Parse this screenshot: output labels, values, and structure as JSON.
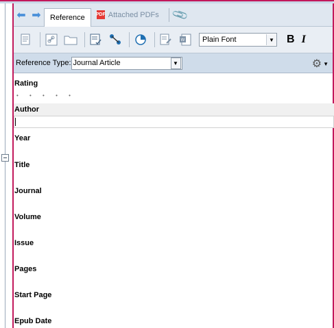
{
  "tabs": {
    "reference_label": "Reference",
    "attached_pdfs_label": "Attached PDFs"
  },
  "toolbar": {
    "font_select_value": "Plain Font",
    "bold_label": "B",
    "italic_label": "I"
  },
  "reference_type": {
    "label": "Reference Type:",
    "value": "Journal Article"
  },
  "fields": [
    {
      "label": "Rating"
    },
    {
      "label": "Author"
    },
    {
      "label": "Year"
    },
    {
      "label": "Title"
    },
    {
      "label": "Journal"
    },
    {
      "label": "Volume"
    },
    {
      "label": "Issue"
    },
    {
      "label": "Pages"
    },
    {
      "label": "Start Page"
    },
    {
      "label": "Epub Date"
    }
  ],
  "rating_dots": "• • • • •",
  "colors": {
    "accent_pink": "#c2185b",
    "toolbar_bg": "#e9eef4",
    "reftype_bg": "#cfdcea"
  }
}
